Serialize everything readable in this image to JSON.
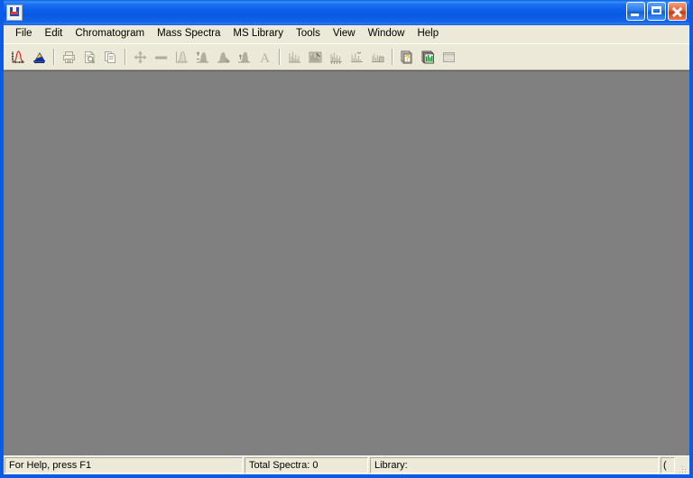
{
  "window": {
    "title": "",
    "icon_name": "app-u-tube-icon",
    "frame_color": "#0a5ce8",
    "client_color": "#808080",
    "controls": [
      {
        "name": "minimize-button",
        "label": "Minimize"
      },
      {
        "name": "maximize-button",
        "label": "Maximize"
      },
      {
        "name": "close-button",
        "label": "Close"
      }
    ]
  },
  "menu": {
    "items": [
      {
        "label": "File"
      },
      {
        "label": "Edit"
      },
      {
        "label": "Chromatogram"
      },
      {
        "label": "Mass Spectra"
      },
      {
        "label": "MS Library"
      },
      {
        "label": "Tools"
      },
      {
        "label": "View"
      },
      {
        "label": "Window"
      },
      {
        "label": "Help"
      }
    ]
  },
  "toolbar": {
    "groups": [
      {
        "buttons": [
          {
            "name": "open-chromatogram-button",
            "icon": "chromatogram-peak-icon",
            "enabled": true
          },
          {
            "name": "open-mass-spectrum-button",
            "icon": "mass-spectrum-icon",
            "enabled": true
          }
        ]
      },
      {
        "buttons": [
          {
            "name": "print-button",
            "icon": "printer-icon",
            "enabled": false
          },
          {
            "name": "print-preview-button",
            "icon": "print-preview-icon",
            "enabled": false
          },
          {
            "name": "copy-button",
            "icon": "copy-icon",
            "enabled": false
          }
        ]
      },
      {
        "buttons": [
          {
            "name": "move-button",
            "icon": "move-arrows-icon",
            "enabled": false
          },
          {
            "name": "baseline-button",
            "icon": "baseline-icon",
            "enabled": false
          },
          {
            "name": "integrate-button",
            "icon": "integrate-area-icon",
            "enabled": false
          },
          {
            "name": "peak-detect-left-button",
            "icon": "peak-left-icon",
            "enabled": false
          },
          {
            "name": "peak-detect-right-button",
            "icon": "peak-right-icon",
            "enabled": false
          },
          {
            "name": "peak-detect-center-button",
            "icon": "peak-center-icon",
            "enabled": false
          },
          {
            "name": "label-text-button",
            "icon": "text-label-icon",
            "enabled": false
          }
        ]
      },
      {
        "buttons": [
          {
            "name": "show-spectrum-button",
            "icon": "spectrum-bars-icon",
            "enabled": false
          },
          {
            "name": "subtract-spectrum-button",
            "icon": "spectrum-subtract-icon",
            "enabled": false
          },
          {
            "name": "compare-spectra-button",
            "icon": "spectrum-compare-icon",
            "enabled": false
          },
          {
            "name": "average-spectra-button",
            "icon": "spectrum-average-icon",
            "enabled": false
          },
          {
            "name": "background-spectrum-button",
            "icon": "spectrum-background-icon",
            "enabled": false
          }
        ]
      },
      {
        "buttons": [
          {
            "name": "library-search-button",
            "icon": "library-search-question-icon",
            "enabled": true
          },
          {
            "name": "library-browse-button",
            "icon": "library-green-chart-icon",
            "enabled": true
          },
          {
            "name": "library-table-button",
            "icon": "library-table-icon",
            "enabled": false
          }
        ]
      }
    ]
  },
  "status_bar": {
    "help_text": "For Help, press F1",
    "total_spectra": "Total Spectra: 0",
    "library": "Library:",
    "extra": "(",
    "grip_name": "resize-grip"
  }
}
